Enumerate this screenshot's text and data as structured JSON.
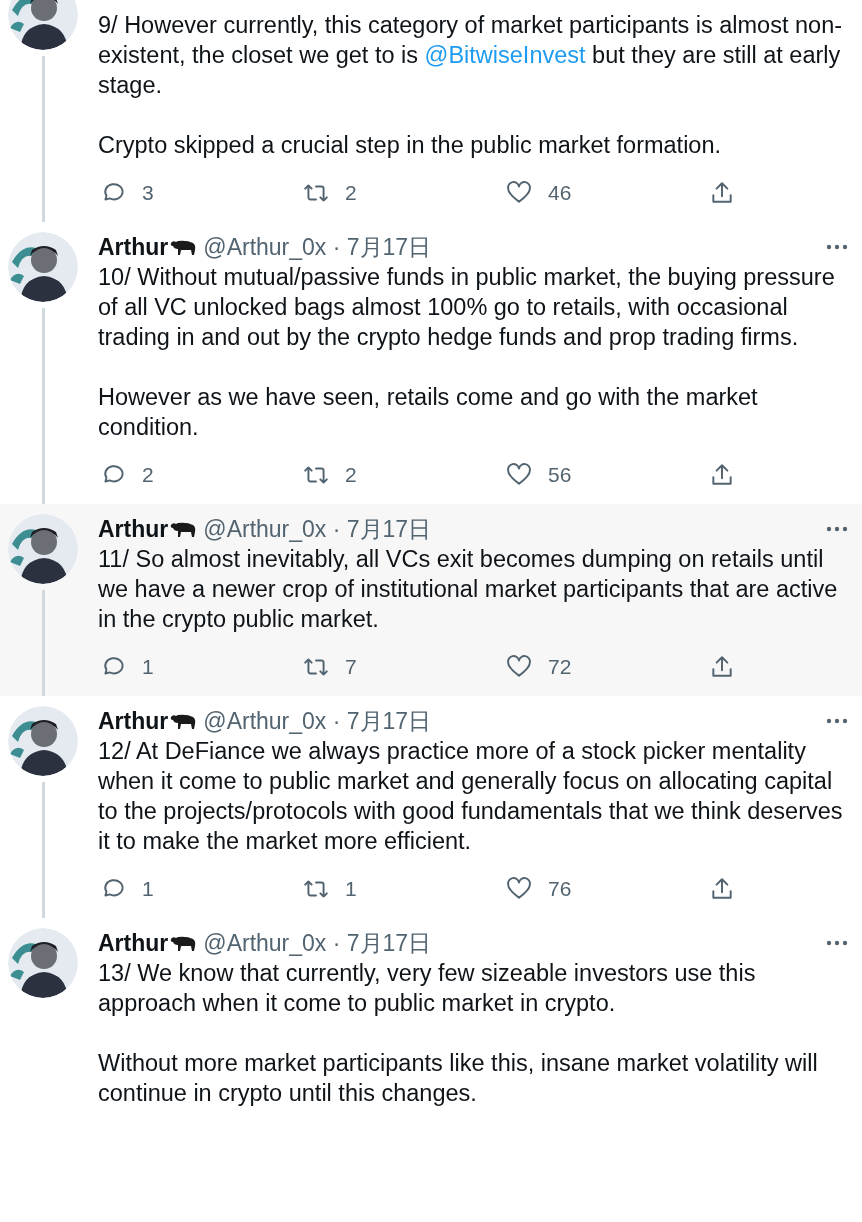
{
  "tweets": [
    {
      "highlighted": false,
      "thread_below": true,
      "paragraphs": [
        [
          {
            "kind": "text",
            "text": "9/ However currently, this category of market participants is almost non-existent, the closet we get to is "
          },
          {
            "kind": "mention",
            "text": "@BitwiseInvest"
          },
          {
            "kind": "text",
            "text": " but they are still at early stage."
          }
        ],
        [
          {
            "kind": "text",
            "text": "Crypto skipped a crucial step in the public market formation."
          }
        ]
      ],
      "replies": "3",
      "retweets": "2",
      "likes": "46"
    },
    {
      "highlighted": false,
      "thread_below": true,
      "name": "Arthur",
      "meta": "@Arthur_0x · 7月17日",
      "paragraphs": [
        [
          {
            "kind": "text",
            "text": "10/ Without mutual/passive funds in public market, the buying pressure of all VC unlocked bags almost 100% go to retails, with occasional trading in and out by the crypto hedge funds and prop trading firms."
          }
        ],
        [
          {
            "kind": "text",
            "text": "However as we have seen, retails come and go with the market condition."
          }
        ]
      ],
      "replies": "2",
      "retweets": "2",
      "likes": "56"
    },
    {
      "highlighted": true,
      "thread_below": true,
      "name": "Arthur",
      "meta": "@Arthur_0x · 7月17日",
      "paragraphs": [
        [
          {
            "kind": "text",
            "text": "11/ So almost inevitably, all VCs exit becomes dumping on retails until we  have a newer crop of institutional market participants that are active in the crypto public market."
          }
        ]
      ],
      "replies": "1",
      "retweets": "7",
      "likes": "72"
    },
    {
      "highlighted": false,
      "thread_below": true,
      "name": "Arthur",
      "meta": "@Arthur_0x · 7月17日",
      "paragraphs": [
        [
          {
            "kind": "text",
            "text": "12/ At DeFiance we always practice more of a stock picker mentality when it come to public market and generally focus on allocating capital to the projects/protocols with good fundamentals that we think deserves it to make the market more efficient."
          }
        ]
      ],
      "replies": "1",
      "retweets": "1",
      "likes": "76"
    },
    {
      "highlighted": false,
      "thread_below": false,
      "name": "Arthur",
      "meta": "@Arthur_0x · 7月17日",
      "paragraphs": [
        [
          {
            "kind": "text",
            "text": "13/ We know that currently, very few sizeable investors use this approach when it come to public market in crypto."
          }
        ],
        [
          {
            "kind": "text",
            "text": "Without more market participants like this, insane market volatility will continue in crypto until this changes."
          }
        ]
      ]
    }
  ]
}
